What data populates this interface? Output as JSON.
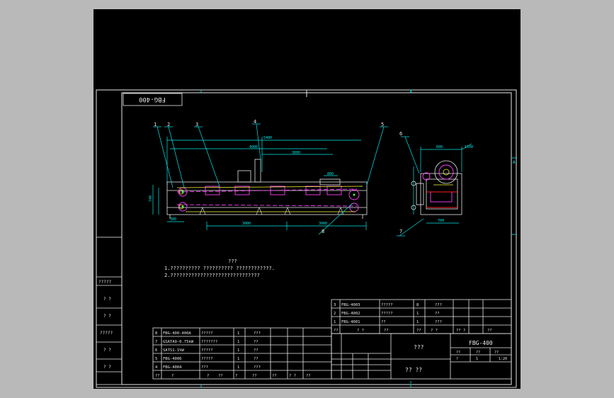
{
  "drawing": {
    "code_box": "FBG-400",
    "part_numbers": [
      "1",
      "2",
      "3",
      "4",
      "5",
      "6",
      "7",
      "8"
    ],
    "dims": {
      "top_overall": "5400",
      "d2": "4900",
      "d3": "3000",
      "d4": "800",
      "height_left": "740",
      "left_small": "380",
      "bottom_span": "3000",
      "bottom_span2": "3000",
      "side_top": "600",
      "side_width": "700",
      "side_bottom": "1100"
    },
    "notes_title": "???",
    "notes": [
      "1.?????????? ?????????? ????????????.",
      "2.??????????????????????????????"
    ],
    "frame_marks": [
      "1",
      "2",
      "3",
      "4",
      "A"
    ]
  },
  "bom_left": [
    {
      "no": "8",
      "code": "FBG-400-400A",
      "name": "?????",
      "qty": "1",
      "mat": "???"
    },
    {
      "no": "7",
      "code": "GSATA9-0.75kW",
      "name": "???????",
      "qty": "1",
      "mat": "??"
    },
    {
      "no": "6",
      "code": "SATS1-1%W",
      "name": "?????",
      "qty": "1",
      "mat": "??"
    },
    {
      "no": "5",
      "code": "FBG-4006",
      "name": "?????",
      "qty": "1",
      "mat": "??"
    },
    {
      "no": "4",
      "code": "FBG-4004",
      "name": "???",
      "qty": "1",
      "mat": "???"
    }
  ],
  "bom_left_header": [
    "??",
    "?",
    "?",
    "??",
    "?",
    "??",
    "??",
    "? ?",
    "??"
  ],
  "bom_right": [
    {
      "no": "3",
      "code": "FBG-4003",
      "name": "?????",
      "qty": "8",
      "mat": "???"
    },
    {
      "no": "2",
      "code": "FBG-4002",
      "name": "?????",
      "qty": "1",
      "mat": "??"
    },
    {
      "no": "1",
      "code": "FBG-4001",
      "name": "??",
      "qty": "1",
      "mat": "???"
    }
  ],
  "bom_right_header": [
    "??",
    "? ?",
    "??",
    "??",
    "?  ?",
    "?? ?",
    "??"
  ],
  "title_block": {
    "name_cell": "???",
    "code": "FBG-400",
    "company": "?? ??",
    "scale": "1:20",
    "row_a": [
      "??",
      "??",
      "??"
    ],
    "row_b": [
      "?",
      "1",
      "?"
    ]
  },
  "side_column": [
    "?????",
    "? ?",
    "? ?",
    "?????",
    "? ?",
    "? ?"
  ]
}
